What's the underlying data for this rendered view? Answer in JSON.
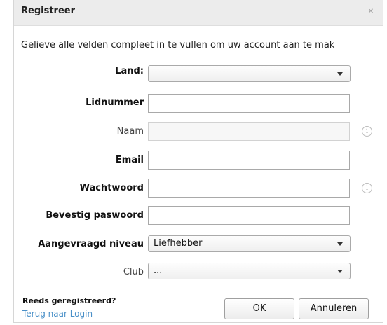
{
  "dialog": {
    "title": "Registreer",
    "close_icon": "close-icon",
    "intro": "Gelieve alle velden compleet in te vullen om uw account aan te mak"
  },
  "form": {
    "land": {
      "label": "Land:",
      "value": ""
    },
    "lidnummer": {
      "label": "Lidnummer",
      "value": ""
    },
    "naam": {
      "label": "Naam",
      "value": "",
      "info_icon": "info-icon"
    },
    "email": {
      "label": "Email",
      "value": ""
    },
    "wachtwoord": {
      "label": "Wachtwoord",
      "value": "",
      "info_icon": "info-icon"
    },
    "bevestig": {
      "label": "Bevestig paswoord",
      "value": ""
    },
    "niveau": {
      "label": "Aangevraagd niveau",
      "value": "Liefhebber"
    },
    "club": {
      "label": "Club",
      "value": "..."
    }
  },
  "footer": {
    "already_registered": "Reeds geregistreerd?",
    "login_link": "Terug naar Login",
    "ok_label": "OK",
    "cancel_label": "Annuleren"
  },
  "colors": {
    "titlebar_bg": "#ececec",
    "link": "#4a90c8"
  }
}
